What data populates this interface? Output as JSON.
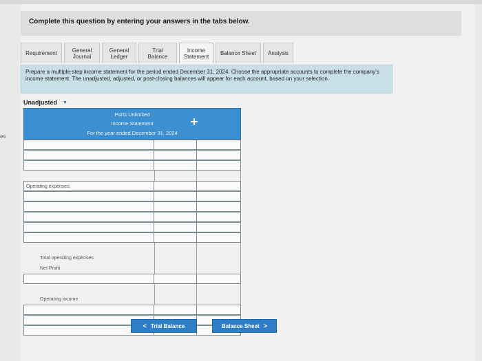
{
  "page": {
    "header": "Complete this question by entering your answers in the tabs below.",
    "side_text": "es"
  },
  "tabs": [
    {
      "label": "Requirement",
      "active": false
    },
    {
      "label": "General Journal",
      "active": false
    },
    {
      "label": "General Ledger",
      "active": false
    },
    {
      "label": "Trial Balance",
      "active": false
    },
    {
      "label": "Income Statement",
      "active": true
    },
    {
      "label": "Balance Sheet",
      "active": false
    },
    {
      "label": "Analysis",
      "active": false
    }
  ],
  "instructions": "Prepare a multiple-step income statement for the period ended December 31, 2024. Choose the appropriate accounts to complete the company's income statement. The unadjusted, adjusted, or post-closing balances will appear for each account, based on your selection.",
  "dropdown": {
    "selected": "Unadjusted"
  },
  "statement": {
    "company": "Parts Unlimited",
    "title": "Income Statement",
    "period": "For the year ended December 31, 2024",
    "labels": {
      "operating_expenses": "Operating expenses:",
      "total_operating_expenses": "Total operating expenses",
      "net_profit": "Net Profit",
      "operating_income": "Operating income"
    }
  },
  "nav": {
    "prev_label": "Trial Balance",
    "next_label": "Balance Sheet"
  },
  "colors": {
    "header_blue": "#3c8fd0",
    "instruction_bg": "#c9dfe8",
    "button_blue": "#2f7fc8"
  }
}
